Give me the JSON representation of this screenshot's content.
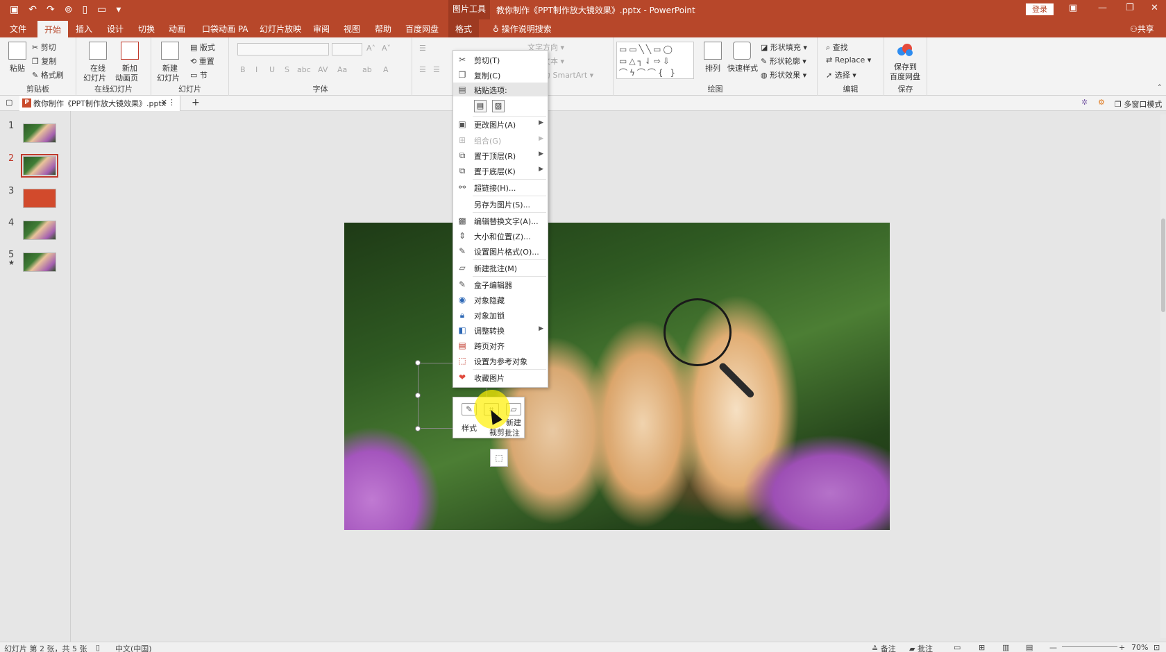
{
  "titlebar": {
    "context_tool": "图片工具",
    "doc_title": "教你制作《PPT制作放大镜效果》.pptx  -  PowerPoint",
    "login": "登录",
    "qat_icons": [
      "save-icon",
      "undo-icon",
      "redo-icon",
      "present-icon",
      "new-icon",
      "open-icon",
      "customize-icon"
    ]
  },
  "tabs": {
    "file": "文件",
    "home": "开始",
    "insert": "插入",
    "design": "设计",
    "transitions": "切换",
    "animations": "动画",
    "pocket": "口袋动画 PA",
    "slideshow": "幻灯片放映",
    "review": "审阅",
    "view": "视图",
    "help": "帮助",
    "baidu": "百度网盘",
    "format": "格式",
    "tell_me": "操作说明搜索",
    "share": "共享"
  },
  "ribbon": {
    "clipboard": {
      "paste": "粘贴",
      "cut": "剪切",
      "copy": "复制",
      "format_painter": "格式刷",
      "label": "剪贴板"
    },
    "online": {
      "online_slide": "在线",
      "online_slide2": "幻灯片",
      "new_anim": "新加",
      "new_anim2": "动画页",
      "label": "在线幻灯片"
    },
    "slides": {
      "new_slide": "新建",
      "new_slide2": "幻灯片",
      "layout": "版式",
      "reset": "重置",
      "section": "节",
      "label": "幻灯片"
    },
    "font": {
      "label": "字体",
      "bold": "B",
      "italic": "I",
      "underline": "U",
      "shadow": "S",
      "strike": "abc"
    },
    "paragraph": {
      "text_dir": "文字方向",
      "align_text": "对齐文本",
      "smartart": "转换为 SmartArt"
    },
    "drawing": {
      "arrange": "排列",
      "quick_styles": "快速样式",
      "shape_fill": "形状填充",
      "shape_outline": "形状轮廓",
      "shape_effects": "形状效果",
      "label": "绘图"
    },
    "editing": {
      "find": "查找",
      "replace": "Replace",
      "select": "选择",
      "label": "编辑"
    },
    "save": {
      "save_baidu": "保存到",
      "save_baidu2": "百度网盘",
      "label": "保存"
    }
  },
  "docstrip": {
    "tab_title": "教你制作《PPT制作放大镜效果》.pptx",
    "multiwindow": "多窗口模式"
  },
  "thumbnails": [
    {
      "num": "1"
    },
    {
      "num": "2"
    },
    {
      "num": "3"
    },
    {
      "num": "4"
    },
    {
      "num": "5"
    }
  ],
  "context_menu": {
    "cut": "剪切(T)",
    "copy": "复制(C)",
    "paste_options": "粘贴选项:",
    "change_picture": "更改图片(A)",
    "group": "组合(G)",
    "bring_front": "置于顶层(R)",
    "send_back": "置于底层(K)",
    "hyperlink": "超链接(H)...",
    "save_as_picture": "另存为图片(S)...",
    "alt_text": "编辑替换文字(A)...",
    "size_position": "大小和位置(Z)...",
    "format_picture": "设置图片格式(O)...",
    "new_comment": "新建批注(M)",
    "box_editor": "盒子编辑器",
    "hide_object": "对象隐藏",
    "lock_object": "对象加锁",
    "adjust_convert": "调整转换",
    "cross_align": "跨页对齐",
    "set_reference": "设置为参考对象",
    "favorite_picture": "收藏图片"
  },
  "mini_toolbar": {
    "style": "样式",
    "crop": "裁剪",
    "new": "新建",
    "comment": "批注"
  },
  "statusbar": {
    "slide_info": "幻灯片 第 2 张，共 5 张",
    "language": "中文(中国)",
    "notes": "备注",
    "comments": "批注",
    "zoom": "70%"
  }
}
